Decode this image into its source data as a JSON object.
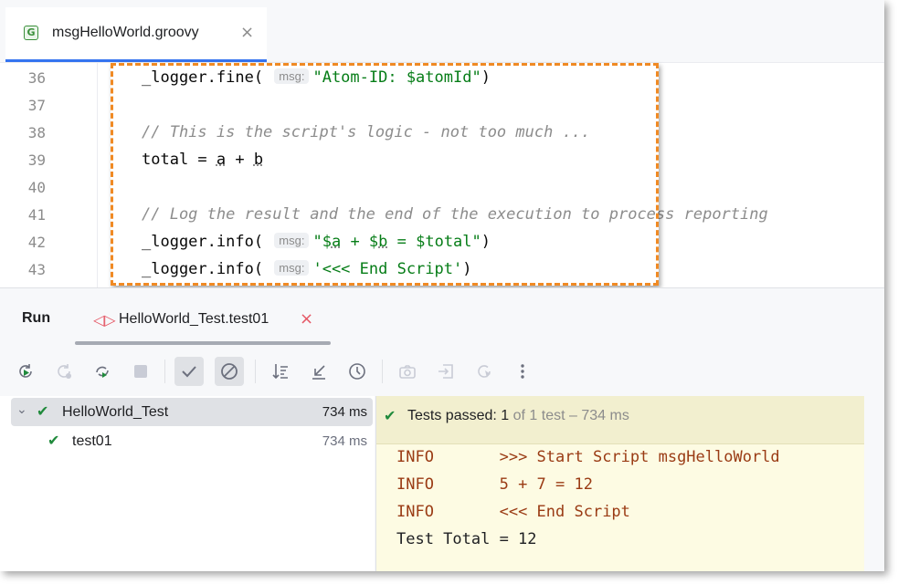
{
  "editor_tab": {
    "icon": "G",
    "label": "msgHelloWorld.groovy",
    "close": "×"
  },
  "editor": {
    "lines": [
      {
        "num": "36",
        "code": [
          {
            "t": "_logger.fine( ",
            "c": ""
          },
          {
            "t": "msg:",
            "c": "hint"
          },
          {
            "t": "\"Atom-ID: $atomId\"",
            "c": "str"
          },
          {
            "t": ")",
            "c": ""
          }
        ]
      },
      {
        "num": "37",
        "code": []
      },
      {
        "num": "38",
        "code": [
          {
            "t": "// This is the script's logic - not too much ...",
            "c": "cmt"
          }
        ]
      },
      {
        "num": "39",
        "code": [
          {
            "t": "total = ",
            "c": ""
          },
          {
            "t": "a",
            "c": "var-u"
          },
          {
            "t": " + ",
            "c": ""
          },
          {
            "t": "b",
            "c": "var-u"
          }
        ]
      },
      {
        "num": "40",
        "code": []
      },
      {
        "num": "41",
        "code": [
          {
            "t": "// Log the result and the end of the execution to process reporting",
            "c": "cmt"
          }
        ]
      },
      {
        "num": "42",
        "code": [
          {
            "t": "_logger.info( ",
            "c": ""
          },
          {
            "t": "msg:",
            "c": "hint"
          },
          {
            "t": "\"$",
            "c": "str"
          },
          {
            "t": "a",
            "c": "str var-u"
          },
          {
            "t": " + $",
            "c": "str"
          },
          {
            "t": "b",
            "c": "str var-u"
          },
          {
            "t": " = $total\"",
            "c": "str"
          },
          {
            "t": ")",
            "c": ""
          }
        ]
      },
      {
        "num": "43",
        "code": [
          {
            "t": "_logger.info( ",
            "c": ""
          },
          {
            "t": "msg:",
            "c": "hint"
          },
          {
            "t": "'<<< End Script'",
            "c": "str"
          },
          {
            "t": ")",
            "c": ""
          }
        ]
      }
    ]
  },
  "run_panel": {
    "title": "Run",
    "tab_label": "HelloWorld_Test.test01",
    "tab_close": "×"
  },
  "toolbar": {
    "icons": [
      "rerun-icon",
      "rerun-failed-icon",
      "rerun-toggle-icon",
      "stop-icon",
      "show-passed-icon",
      "show-ignored-icon",
      "sort-icon",
      "collapse-icon",
      "history-icon",
      "camera-icon",
      "export-icon",
      "import-icon",
      "more-icon"
    ]
  },
  "tree": {
    "root": {
      "label": "HelloWorld_Test",
      "time": "734 ms"
    },
    "child": {
      "label": "test01",
      "time": "734 ms"
    }
  },
  "console": {
    "status_prefix": "Tests passed: ",
    "status_count": "1",
    "status_suffix": " of 1 test – 734 ms",
    "lines": [
      {
        "level": "INFO",
        "msg": ">>> Start Script msgHelloWorld"
      },
      {
        "level": "INFO",
        "msg": "5 + 7 = 12"
      },
      {
        "level": "INFO",
        "msg": "<<< End Script"
      }
    ],
    "final_line": "Test Total = 12"
  },
  "colors": {
    "accent": "#3574f0",
    "highlight_border": "#f08a24",
    "pass_green": "#208a3c",
    "console_bg": "#fdfbe3"
  }
}
